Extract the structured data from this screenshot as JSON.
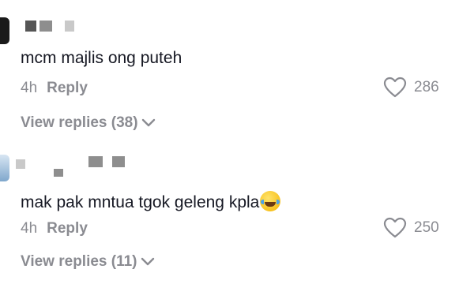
{
  "comments": [
    {
      "text": "mcm majlis ong puteh",
      "time": "4h",
      "reply_label": "Reply",
      "likes": "286",
      "view_replies": "View replies (38)"
    },
    {
      "text": "mak pak mntua tgok geleng kpla",
      "emoji": "face-with-tears-of-joy-emoji",
      "time": "4h",
      "reply_label": "Reply",
      "likes": "250",
      "view_replies": "View replies (11)"
    }
  ],
  "colors": {
    "primary_text": "#161823",
    "secondary_text": "#8a8b91"
  }
}
